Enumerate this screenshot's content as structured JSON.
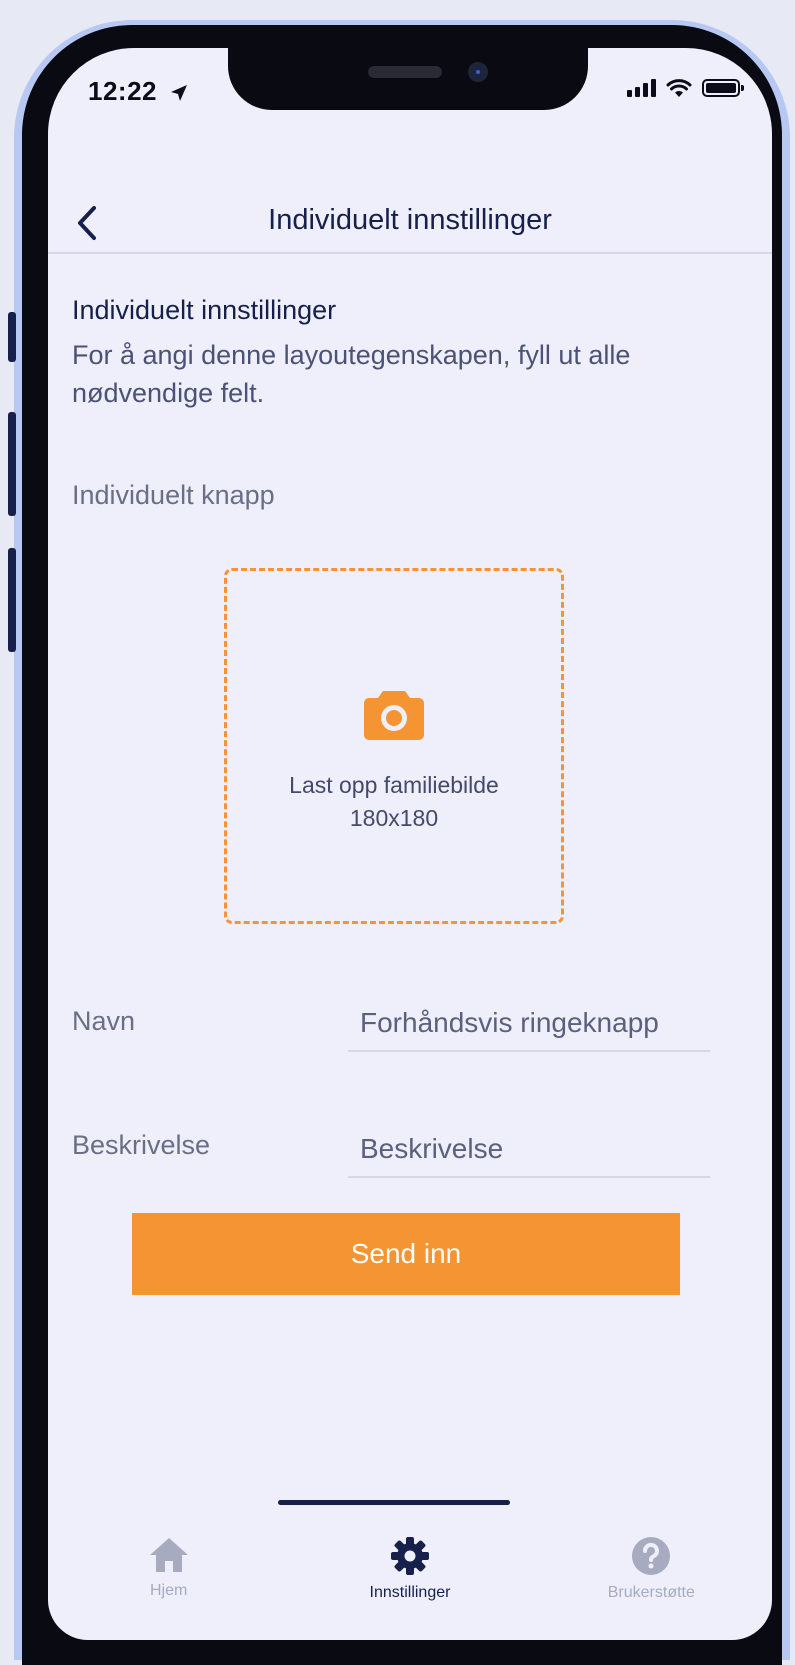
{
  "status_bar": {
    "time": "12:22",
    "location_icon": "location-arrow-icon",
    "signal_icon": "cellular-signal-icon",
    "wifi_icon": "wifi-icon",
    "battery_icon": "battery-icon"
  },
  "navbar": {
    "back_icon": "chevron-left-icon",
    "title": "Individuelt innstillinger"
  },
  "section": {
    "title": "Individuelt innstillinger",
    "description": "For å angi denne layoutegenskapen, fyll ut alle nødvendige felt."
  },
  "upload": {
    "field_label": "Individuelt knapp",
    "icon": "camera-icon",
    "label": "Last opp familiebilde",
    "size": "180x180"
  },
  "form": {
    "name_label": "Navn",
    "name_placeholder": "Forhåndsvis ringeknapp",
    "description_label": "Beskrivelse",
    "description_placeholder": "Beskrivelse",
    "submit_label": "Send inn"
  },
  "tabbar": {
    "tabs": [
      {
        "label": "Hjem",
        "icon": "home-icon",
        "active": false
      },
      {
        "label": "Innstillinger",
        "icon": "gear-icon",
        "active": true
      },
      {
        "label": "Brukerstøtte",
        "icon": "help-icon",
        "active": false
      }
    ]
  },
  "colors": {
    "accent": "#f49433",
    "primary_text": "#16204a",
    "background": "#eeeffa",
    "frame_outline": "#b7c8f3"
  }
}
